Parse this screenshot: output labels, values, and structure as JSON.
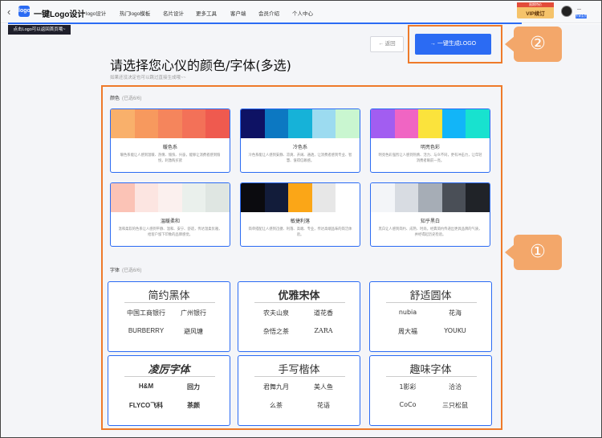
{
  "nav": {
    "brand": "一键Logo设计",
    "logo_mark": "logo",
    "items": [
      "logo设计",
      "热门logo模板",
      "名片设计",
      "更多工具",
      "客户端",
      "会员介绍",
      "个人中心"
    ],
    "vip_tag": "限期特价",
    "vip_label": "VIP续订",
    "account_badge": "东家会员"
  },
  "tooltip": "点击Logo可以返回首页哦~",
  "actions": {
    "back": "← 返回",
    "generate": "→  一键生成LOGO"
  },
  "callouts": {
    "one": "①",
    "two": "②"
  },
  "page": {
    "title": "请选择您心仪的颜色/字体(多选)",
    "subtitle": "如果还没决定也可以跳过直接生成哦~~"
  },
  "colors_section": {
    "label": "颜色",
    "count": "(已选6/6)",
    "cards": [
      {
        "name": "暖色系",
        "desc": "暖色系能让人感到温暖、热情、愉快、兴奋，能够让消费者感到愉悦，刺激购买欲",
        "swatches": [
          "#f9b06b",
          "#f7995e",
          "#f5855c",
          "#f37158",
          "#ef5a4f"
        ]
      },
      {
        "name": "冷色系",
        "desc": "冷色系能让人感到安静、凉爽、开阔、通透，让消费者感到专业、智慧、值得信赖感。",
        "swatches": [
          "#0e1264",
          "#0c78c2",
          "#16b2d8",
          "#9cdbf0",
          "#c9f6d0"
        ]
      },
      {
        "name": "明亮色彩",
        "desc": "明亮色彩强烈让人感到热情、活力、与众不同，更有冲击力，让年轻消费者眼前一亮。",
        "swatches": [
          "#a25df1",
          "#f065c3",
          "#fbe33c",
          "#12b5f8",
          "#18e2cf"
        ]
      },
      {
        "name": "温暖柔和",
        "desc": "温和柔软的色系让人感到平静、温和、安宁、舒适，传达温柔优雅，给客户留下印象的品牌感觉。",
        "swatches": [
          "#fbc3b6",
          "#fce5e1",
          "#fbf0ee",
          "#eaf0ec",
          "#dfe6e2"
        ]
      },
      {
        "name": "敏捷利落",
        "desc": "简单搭配让人感到迅捷、利落、高端、专业，传达高端品味的简洁体验。",
        "swatches": [
          "#0b0b0f",
          "#121c3a",
          "#fba617",
          "#e7e7e7",
          "#ffffff"
        ]
      },
      {
        "name": "知乎黑白",
        "desc": "黑白让人感到简约、成熟、时尚，经典简约传递出更具品牌的气质，并经得起历史检验。",
        "swatches": [
          "#f3f5f8",
          "#d8dce2",
          "#a6adb6",
          "#4a4f57",
          "#202328"
        ]
      }
    ]
  },
  "fonts_section": {
    "label": "字体",
    "count": "(已选6/6)",
    "cards": [
      {
        "name": "简约黑体",
        "samples": [
          "中国工商银行",
          "广州银行",
          "BURBERRY",
          "避风塘"
        ]
      },
      {
        "name": "优雅宋体",
        "samples": [
          "农夫山泉",
          "道花香",
          "杂悟之茶",
          "ZARA"
        ]
      },
      {
        "name": "舒适圆体",
        "samples": [
          "nubia",
          "花海",
          "周大福",
          "YOUKU"
        ]
      },
      {
        "name": "凌厉字体",
        "samples": [
          "H&M",
          "回力",
          "FLYCO飞科",
          "茶颜"
        ]
      },
      {
        "name": "手写楷体",
        "samples": [
          "君舞九月",
          "美人鱼",
          "么茶",
          "花语"
        ]
      },
      {
        "name": "趣味字体",
        "samples": [
          "1影彩",
          "洽洽",
          "CoCo",
          "三只松鼠"
        ]
      }
    ]
  },
  "colors": {
    "accent": "#2b6bf3",
    "highlight": "#ee7a2a",
    "callout": "#f3a76a"
  }
}
